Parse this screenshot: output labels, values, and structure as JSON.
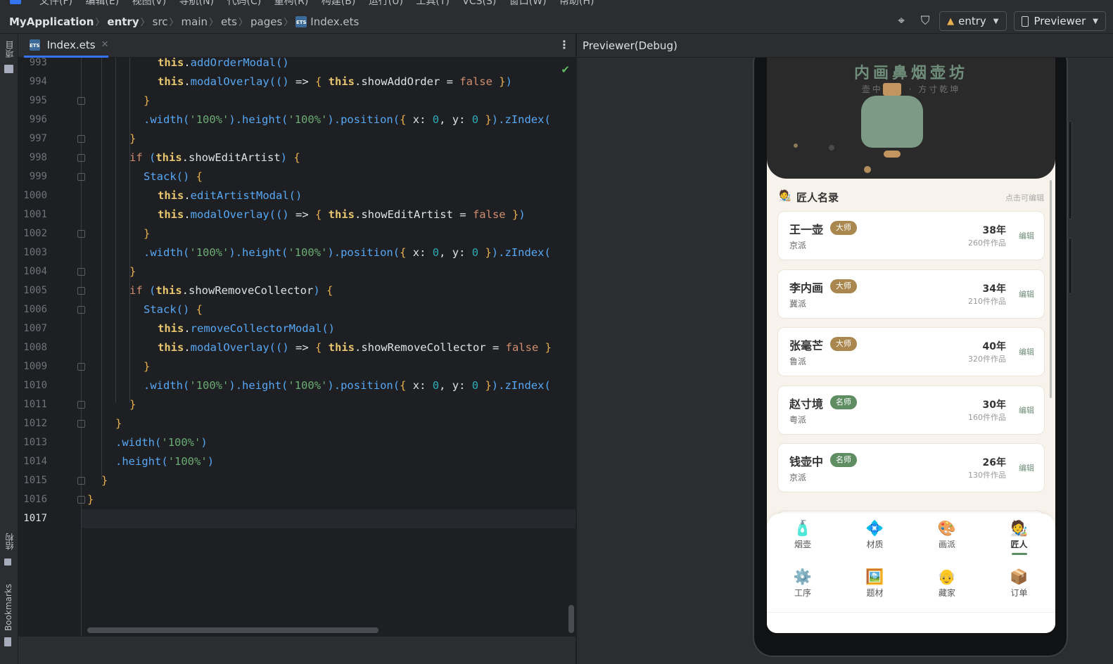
{
  "menubar": {
    "items": [
      "文件(F)",
      "编辑(E)",
      "视图(V)",
      "导航(N)",
      "代码(C)",
      "重构(R)",
      "构建(B)",
      "运行(U)",
      "工具(T)",
      "VCS(S)",
      "窗口(W)",
      "帮助(H)"
    ]
  },
  "breadcrumb": {
    "project": "MyApplication",
    "module": "entry",
    "folders": [
      "src",
      "main",
      "ets",
      "pages"
    ],
    "file": "Index.ets",
    "file_icon_text": "ETS"
  },
  "toolbar": {
    "run_config": "entry",
    "device": "Previewer"
  },
  "left_strip": {
    "project_label": "项目",
    "structure_label": "结构",
    "bookmarks_label": "Bookmarks"
  },
  "editor": {
    "tab_label": "Index.ets",
    "tab_icon_text": "ETS",
    "current_line": 1017,
    "lines": [
      {
        "n": "993",
        "indent": 5,
        "tokens": [
          [
            "th",
            "this"
          ],
          [
            "id",
            "."
          ],
          [
            "fn",
            "addOrderModal"
          ],
          [
            "br3",
            "()"
          ]
        ]
      },
      {
        "n": "994",
        "indent": 5,
        "tokens": [
          [
            "th",
            "this"
          ],
          [
            "id",
            "."
          ],
          [
            "fn",
            "modalOverlay"
          ],
          [
            "br3",
            "(() "
          ],
          [
            "id",
            "=> "
          ],
          [
            "br1",
            "{ "
          ],
          [
            "th",
            "this"
          ],
          [
            "id",
            ".showAddOrder = "
          ],
          [
            "kw",
            "false"
          ],
          [
            "br1",
            " }"
          ],
          [
            "br3",
            ")"
          ]
        ]
      },
      {
        "n": "995",
        "indent": 4,
        "tokens": [
          [
            "br1",
            "}"
          ]
        ]
      },
      {
        "n": "996",
        "indent": 4,
        "tokens": [
          [
            "me",
            "."
          ],
          [
            "fn",
            "width"
          ],
          [
            "br3",
            "("
          ],
          [
            "str",
            "'100%'"
          ],
          [
            "br3",
            ")"
          ],
          [
            "me",
            "."
          ],
          [
            "fn",
            "height"
          ],
          [
            "br3",
            "("
          ],
          [
            "str",
            "'100%'"
          ],
          [
            "br3",
            ")"
          ],
          [
            "me",
            "."
          ],
          [
            "fn",
            "position"
          ],
          [
            "br3",
            "("
          ],
          [
            "br1",
            "{ "
          ],
          [
            "id",
            "x: "
          ],
          [
            "num",
            "0"
          ],
          [
            "id",
            ", y: "
          ],
          [
            "num",
            "0"
          ],
          [
            "br1",
            " }"
          ],
          [
            "br3",
            ")"
          ],
          [
            "me",
            "."
          ],
          [
            "fn",
            "zIndex("
          ]
        ]
      },
      {
        "n": "997",
        "indent": 3,
        "tokens": [
          [
            "br1",
            "}"
          ]
        ]
      },
      {
        "n": "998",
        "indent": 3,
        "tokens": [
          [
            "kw",
            "if "
          ],
          [
            "br3",
            "("
          ],
          [
            "th",
            "this"
          ],
          [
            "id",
            ".showEditArtist"
          ],
          [
            "br3",
            ") "
          ],
          [
            "br1",
            "{"
          ]
        ]
      },
      {
        "n": "999",
        "indent": 4,
        "tokens": [
          [
            "fn",
            "Stack"
          ],
          [
            "br3",
            "() "
          ],
          [
            "br1",
            "{"
          ]
        ]
      },
      {
        "n": "1000",
        "indent": 5,
        "tokens": [
          [
            "th",
            "this"
          ],
          [
            "id",
            "."
          ],
          [
            "fn",
            "editArtistModal"
          ],
          [
            "br3",
            "()"
          ]
        ]
      },
      {
        "n": "1001",
        "indent": 5,
        "tokens": [
          [
            "th",
            "this"
          ],
          [
            "id",
            "."
          ],
          [
            "fn",
            "modalOverlay"
          ],
          [
            "br3",
            "(() "
          ],
          [
            "id",
            "=> "
          ],
          [
            "br1",
            "{ "
          ],
          [
            "th",
            "this"
          ],
          [
            "id",
            ".showEditArtist = "
          ],
          [
            "kw",
            "false"
          ],
          [
            "br1",
            " }"
          ],
          [
            "br3",
            ")"
          ]
        ]
      },
      {
        "n": "1002",
        "indent": 4,
        "tokens": [
          [
            "br1",
            "}"
          ]
        ]
      },
      {
        "n": "1003",
        "indent": 4,
        "tokens": [
          [
            "me",
            "."
          ],
          [
            "fn",
            "width"
          ],
          [
            "br3",
            "("
          ],
          [
            "str",
            "'100%'"
          ],
          [
            "br3",
            ")"
          ],
          [
            "me",
            "."
          ],
          [
            "fn",
            "height"
          ],
          [
            "br3",
            "("
          ],
          [
            "str",
            "'100%'"
          ],
          [
            "br3",
            ")"
          ],
          [
            "me",
            "."
          ],
          [
            "fn",
            "position"
          ],
          [
            "br3",
            "("
          ],
          [
            "br1",
            "{ "
          ],
          [
            "id",
            "x: "
          ],
          [
            "num",
            "0"
          ],
          [
            "id",
            ", y: "
          ],
          [
            "num",
            "0"
          ],
          [
            "br1",
            " }"
          ],
          [
            "br3",
            ")"
          ],
          [
            "me",
            "."
          ],
          [
            "fn",
            "zIndex("
          ]
        ]
      },
      {
        "n": "1004",
        "indent": 3,
        "tokens": [
          [
            "br1",
            "}"
          ]
        ]
      },
      {
        "n": "1005",
        "indent": 3,
        "tokens": [
          [
            "kw",
            "if "
          ],
          [
            "br3",
            "("
          ],
          [
            "th",
            "this"
          ],
          [
            "id",
            ".showRemoveCollector"
          ],
          [
            "br3",
            ") "
          ],
          [
            "br1",
            "{"
          ]
        ]
      },
      {
        "n": "1006",
        "indent": 4,
        "tokens": [
          [
            "fn",
            "Stack"
          ],
          [
            "br3",
            "() "
          ],
          [
            "br1",
            "{"
          ]
        ]
      },
      {
        "n": "1007",
        "indent": 5,
        "tokens": [
          [
            "th",
            "this"
          ],
          [
            "id",
            "."
          ],
          [
            "fn",
            "removeCollectorModal"
          ],
          [
            "br3",
            "()"
          ]
        ]
      },
      {
        "n": "1008",
        "indent": 5,
        "tokens": [
          [
            "th",
            "this"
          ],
          [
            "id",
            "."
          ],
          [
            "fn",
            "modalOverlay"
          ],
          [
            "br3",
            "(() "
          ],
          [
            "id",
            "=> "
          ],
          [
            "br1",
            "{ "
          ],
          [
            "th",
            "this"
          ],
          [
            "id",
            ".showRemoveCollector = "
          ],
          [
            "kw",
            "false"
          ],
          [
            "br1",
            " }"
          ]
        ]
      },
      {
        "n": "1009",
        "indent": 4,
        "tokens": [
          [
            "br1",
            "}"
          ]
        ]
      },
      {
        "n": "1010",
        "indent": 4,
        "tokens": [
          [
            "me",
            "."
          ],
          [
            "fn",
            "width"
          ],
          [
            "br3",
            "("
          ],
          [
            "str",
            "'100%'"
          ],
          [
            "br3",
            ")"
          ],
          [
            "me",
            "."
          ],
          [
            "fn",
            "height"
          ],
          [
            "br3",
            "("
          ],
          [
            "str",
            "'100%'"
          ],
          [
            "br3",
            ")"
          ],
          [
            "me",
            "."
          ],
          [
            "fn",
            "position"
          ],
          [
            "br3",
            "("
          ],
          [
            "br1",
            "{ "
          ],
          [
            "id",
            "x: "
          ],
          [
            "num",
            "0"
          ],
          [
            "id",
            ", y: "
          ],
          [
            "num",
            "0"
          ],
          [
            "br1",
            " }"
          ],
          [
            "br3",
            ")"
          ],
          [
            "me",
            "."
          ],
          [
            "fn",
            "zIndex("
          ]
        ]
      },
      {
        "n": "1011",
        "indent": 3,
        "tokens": [
          [
            "br1",
            "}"
          ]
        ]
      },
      {
        "n": "1012",
        "indent": 2,
        "tokens": [
          [
            "br1",
            "}"
          ]
        ]
      },
      {
        "n": "1013",
        "indent": 2,
        "tokens": [
          [
            "me",
            "."
          ],
          [
            "fn",
            "width"
          ],
          [
            "br3",
            "("
          ],
          [
            "str",
            "'100%'"
          ],
          [
            "br3",
            ")"
          ]
        ]
      },
      {
        "n": "1014",
        "indent": 2,
        "tokens": [
          [
            "me",
            "."
          ],
          [
            "fn",
            "height"
          ],
          [
            "br3",
            "("
          ],
          [
            "str",
            "'100%'"
          ],
          [
            "br3",
            ")"
          ]
        ]
      },
      {
        "n": "1015",
        "indent": 1,
        "tokens": [
          [
            "br1",
            "}"
          ]
        ]
      },
      {
        "n": "1016",
        "indent": 0,
        "tokens": [
          [
            "br1",
            "}"
          ]
        ]
      },
      {
        "n": "1017",
        "indent": 0,
        "tokens": []
      }
    ]
  },
  "previewer": {
    "title": "Previewer(Debug)"
  },
  "app": {
    "hero_title": "内画鼻烟壶坊",
    "hero_subtitle": "壶中日月 · 方寸乾坤",
    "section_icon": "🧑‍🎨",
    "section_title": "匠人名录",
    "section_hint": "点击可编辑",
    "edit_label": "编辑",
    "artists": [
      {
        "name": "王一壶",
        "badge": "大师",
        "badge_color": "#a9874e",
        "school": "京派",
        "years": "38年",
        "works": "260件作品"
      },
      {
        "name": "李内画",
        "badge": "大师",
        "badge_color": "#a9874e",
        "school": "冀派",
        "years": "34年",
        "works": "210件作品"
      },
      {
        "name": "张毫芒",
        "badge": "大师",
        "badge_color": "#a9874e",
        "school": "鲁派",
        "years": "40年",
        "works": "320件作品"
      },
      {
        "name": "赵寸境",
        "badge": "名师",
        "badge_color": "#5e8d62",
        "school": "粤派",
        "years": "30年",
        "works": "160件作品"
      },
      {
        "name": "钱壶中",
        "badge": "名师",
        "badge_color": "#5e8d62",
        "school": "京派",
        "years": "26年",
        "works": "130件作品"
      }
    ],
    "tabs": [
      {
        "icon": "🧴",
        "label": "烟壶",
        "active": false
      },
      {
        "icon": "💠",
        "label": "材质",
        "active": false
      },
      {
        "icon": "🎨",
        "label": "画派",
        "active": false
      },
      {
        "icon": "🧑‍🎨",
        "label": "匠人",
        "active": true
      },
      {
        "icon": "⚙️",
        "label": "工序",
        "active": false
      },
      {
        "icon": "🖼️",
        "label": "题材",
        "active": false
      },
      {
        "icon": "👴",
        "label": "藏家",
        "active": false
      },
      {
        "icon": "📦",
        "label": "订单",
        "active": false
      }
    ]
  }
}
